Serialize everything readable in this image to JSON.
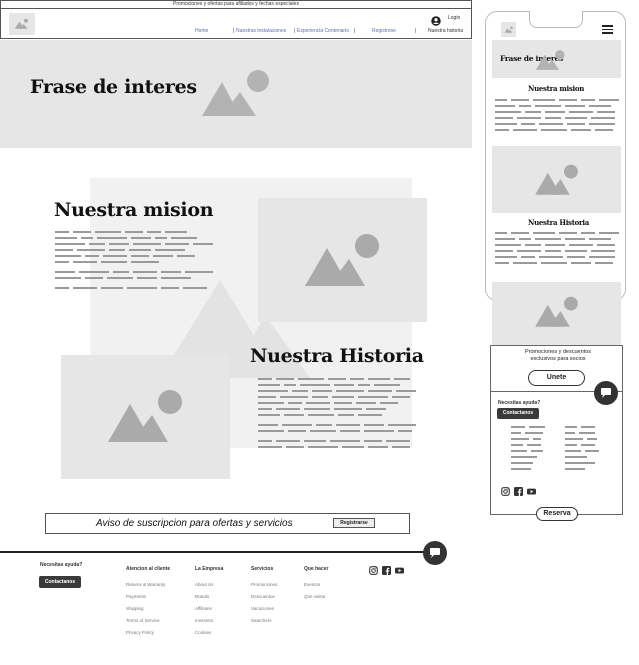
{
  "promo_bar": {
    "text": "Promociones y ofertas para afiliados y fechas especiales"
  },
  "header": {
    "login_label": "Login",
    "nav": [
      {
        "label": "Home"
      },
      {
        "label": "Nuestras instalaciones"
      },
      {
        "label": "Experiencia Centenario"
      },
      {
        "label": "Registrese"
      },
      {
        "label": "Nuestra historia"
      }
    ]
  },
  "banner": {
    "title": "Frase de interes"
  },
  "mission": {
    "title": "Nuestra mision"
  },
  "history": {
    "title": "Nuestra Historia"
  },
  "subscribe": {
    "text": "Aviso de suscripcion para ofertas y servicios",
    "button": "Registrarse"
  },
  "footer": {
    "help_title": "Necesitas ayuda?",
    "contact_button": "Contactanos",
    "columns": [
      {
        "title": "Atencion al cliente",
        "links": [
          "Returns & Warranty",
          "Payments",
          "Shipping",
          "Terms of Service",
          "Privacy Policy"
        ]
      },
      {
        "title": "La Empresa",
        "links": [
          "About Us",
          "Brands",
          "Affiliates",
          "Investors",
          "Cookies"
        ]
      },
      {
        "title": "Servicios",
        "links": [
          "Promociones",
          "Descuentos",
          "Vacaciones",
          "Searchers"
        ]
      },
      {
        "title": "Que hacer",
        "links": [
          "Eventos",
          "Que visitar"
        ]
      }
    ]
  },
  "mobile": {
    "banner_title": "Frase de interes",
    "mission_title": "Nuestra mision",
    "history_title": "Nuestra Historia",
    "promo_text": "Promociones y descuentos exclusivos para socios",
    "join_button": "Unete",
    "help_title": "Necesitas ayuda?",
    "contact_button": "Contactanos",
    "reserve_button": "Reserva"
  },
  "icons": {
    "logo": "image-placeholder-icon",
    "login": "user-circle-icon",
    "chat": "chat-bubble-icon",
    "social": [
      "instagram-icon",
      "facebook-icon",
      "youtube-icon"
    ],
    "menu": "hamburger-menu-icon"
  },
  "colors": {
    "placeholder": "#e6e6e6",
    "nav_link": "#5a6fb0",
    "dark_button": "#3a3a3a"
  }
}
